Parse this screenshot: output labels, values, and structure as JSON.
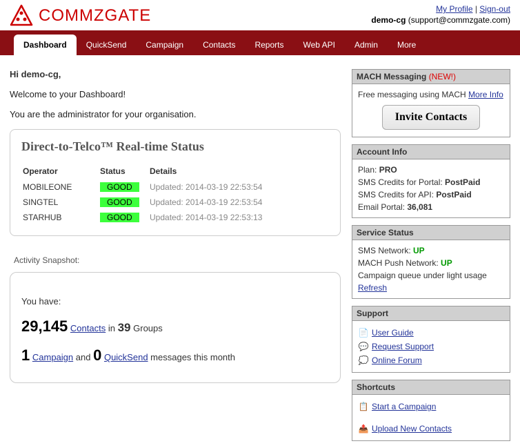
{
  "brand": "COMMZGATE",
  "header": {
    "my_profile": "My Profile",
    "sign_out": "Sign-out",
    "username": "demo-cg",
    "email": "(support@commzgate.com)"
  },
  "nav": {
    "dashboard": "Dashboard",
    "quicksend": "QuickSend",
    "campaign": "Campaign",
    "contacts": "Contacts",
    "reports": "Reports",
    "webapi": "Web API",
    "admin": "Admin",
    "more": "More"
  },
  "greeting": {
    "hi": "Hi demo-cg,",
    "welcome": "Welcome to your Dashboard!",
    "admin_line": "You are the administrator for your organisation."
  },
  "telco": {
    "title": "Direct-to-Telco™ Real-time Status",
    "h_operator": "Operator",
    "h_status": "Status",
    "h_details": "Details",
    "rows": [
      {
        "op": "MOBILEONE",
        "status": "GOOD",
        "details": "Updated: 2014-03-19 22:53:54"
      },
      {
        "op": "SINGTEL",
        "status": "GOOD",
        "details": "Updated: 2014-03-19 22:53:54"
      },
      {
        "op": "STARHUB",
        "status": "GOOD",
        "details": "Updated: 2014-03-19 22:53:13"
      }
    ]
  },
  "activity": {
    "label": "Activity Snapshot:",
    "you_have": "You have:",
    "contacts_count": "29,145",
    "contacts_word": "Contacts",
    "in_word": " in ",
    "groups_count": "39",
    "groups_word": " Groups",
    "campaign_count": "1",
    "campaign_word": "Campaign",
    "and_word": " and ",
    "quicksend_count": "0",
    "quicksend_word": "QuickSend",
    "tail": " messages this month"
  },
  "mach": {
    "head": "MACH Messaging ",
    "new": "(NEW!)",
    "desc": "Free messaging using MACH ",
    "more": "More Info",
    "invite": "Invite Contacts"
  },
  "account": {
    "head": "Account Info",
    "plan_label": "Plan: ",
    "plan_value": "PRO",
    "portal_label": "SMS Credits for Portal: ",
    "portal_value": "PostPaid",
    "api_label": "SMS Credits for API: ",
    "api_value": "PostPaid",
    "email_label": "Email Portal: ",
    "email_value": "36,081"
  },
  "service": {
    "head": "Service Status",
    "sms_label": "SMS Network: ",
    "sms_value": "UP",
    "mach_label": "MACH Push Network: ",
    "mach_value": "UP",
    "queue": "Campaign queue under light usage",
    "refresh": "Refresh"
  },
  "support": {
    "head": "Support",
    "guide": " User Guide",
    "request": " Request Support",
    "forum": " Online Forum"
  },
  "shortcuts": {
    "head": "Shortcuts",
    "start": " Start a Campaign",
    "upload": " Upload New Contacts"
  }
}
